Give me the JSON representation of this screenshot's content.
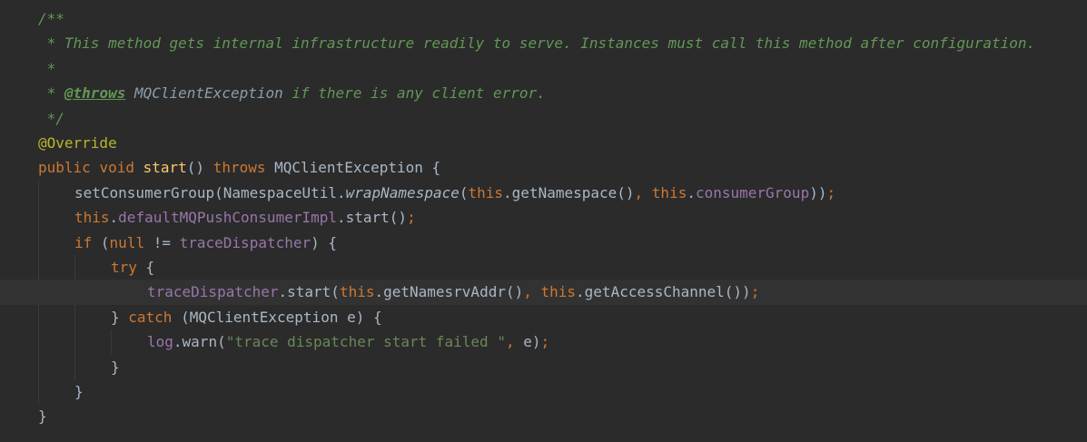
{
  "editor": {
    "current_line_index": 11,
    "lines": [
      {
        "indent": 0,
        "tokens": [
          {
            "t": "/**",
            "c": "cm"
          }
        ]
      },
      {
        "indent": 0,
        "tokens": [
          {
            "t": " * This method gets internal infrastructure readily to serve. Instances must call this method after configuration.",
            "c": "cm"
          }
        ]
      },
      {
        "indent": 0,
        "tokens": [
          {
            "t": " *",
            "c": "cm"
          }
        ]
      },
      {
        "indent": 0,
        "tokens": [
          {
            "t": " * ",
            "c": "cm"
          },
          {
            "t": "@throws",
            "c": "tag"
          },
          {
            "t": " ",
            "c": "cm"
          },
          {
            "t": "MQClientException",
            "c": "doc-ref"
          },
          {
            "t": " if there is any client error.",
            "c": "cm"
          }
        ]
      },
      {
        "indent": 0,
        "tokens": [
          {
            "t": " */",
            "c": "cm"
          }
        ]
      },
      {
        "indent": 0,
        "tokens": [
          {
            "t": "@Override",
            "c": "ann"
          }
        ]
      },
      {
        "indent": 0,
        "tokens": [
          {
            "t": "public ",
            "c": "kw"
          },
          {
            "t": "void ",
            "c": "kw"
          },
          {
            "t": "start",
            "c": "fn"
          },
          {
            "t": "() ",
            "c": ""
          },
          {
            "t": "throws ",
            "c": "kw"
          },
          {
            "t": "MQClientException {",
            "c": ""
          }
        ]
      },
      {
        "indent": 1,
        "tokens": [
          {
            "t": "setConsumerGroup(NamespaceUtil.",
            "c": ""
          },
          {
            "t": "wrapNamespace",
            "c": "static-call"
          },
          {
            "t": "(",
            "c": ""
          },
          {
            "t": "this",
            "c": "kw"
          },
          {
            "t": ".getNamespace()",
            "c": ""
          },
          {
            "t": ", ",
            "c": "kw"
          },
          {
            "t": "this",
            "c": "kw"
          },
          {
            "t": ".",
            "c": ""
          },
          {
            "t": "consumerGroup",
            "c": "field"
          },
          {
            "t": "))",
            "c": ""
          },
          {
            "t": ";",
            "c": "kw"
          }
        ]
      },
      {
        "indent": 1,
        "tokens": [
          {
            "t": "this",
            "c": "kw"
          },
          {
            "t": ".",
            "c": ""
          },
          {
            "t": "defaultMQPushConsumerImpl",
            "c": "field"
          },
          {
            "t": ".start()",
            "c": ""
          },
          {
            "t": ";",
            "c": "kw"
          }
        ]
      },
      {
        "indent": 1,
        "tokens": [
          {
            "t": "if ",
            "c": "kw"
          },
          {
            "t": "(",
            "c": ""
          },
          {
            "t": "null ",
            "c": "kw"
          },
          {
            "t": "!= ",
            "c": ""
          },
          {
            "t": "traceDispatcher",
            "c": "field"
          },
          {
            "t": ") {",
            "c": ""
          }
        ]
      },
      {
        "indent": 2,
        "tokens": [
          {
            "t": "try ",
            "c": "kw"
          },
          {
            "t": "{",
            "c": ""
          }
        ]
      },
      {
        "indent": 3,
        "tokens": [
          {
            "t": "traceDispatcher",
            "c": "field"
          },
          {
            "t": ".start(",
            "c": ""
          },
          {
            "t": "this",
            "c": "kw"
          },
          {
            "t": ".getNamesrvAddr()",
            "c": ""
          },
          {
            "t": ", ",
            "c": "kw"
          },
          {
            "t": "this",
            "c": "kw"
          },
          {
            "t": ".getAccessChannel())",
            "c": ""
          },
          {
            "t": ";",
            "c": "kw"
          }
        ]
      },
      {
        "indent": 2,
        "tokens": [
          {
            "t": "} ",
            "c": ""
          },
          {
            "t": "catch ",
            "c": "kw"
          },
          {
            "t": "(MQClientException e) {",
            "c": ""
          }
        ]
      },
      {
        "indent": 3,
        "tokens": [
          {
            "t": "log",
            "c": "field"
          },
          {
            "t": ".warn(",
            "c": ""
          },
          {
            "t": "\"trace dispatcher start failed \"",
            "c": "str"
          },
          {
            "t": ", ",
            "c": "kw"
          },
          {
            "t": "e)",
            "c": ""
          },
          {
            "t": ";",
            "c": "kw"
          }
        ]
      },
      {
        "indent": 2,
        "tokens": [
          {
            "t": "}",
            "c": ""
          }
        ]
      },
      {
        "indent": 1,
        "tokens": [
          {
            "t": "}",
            "c": ""
          }
        ]
      },
      {
        "indent": 0,
        "tokens": [
          {
            "t": "}",
            "c": ""
          }
        ]
      }
    ]
  }
}
